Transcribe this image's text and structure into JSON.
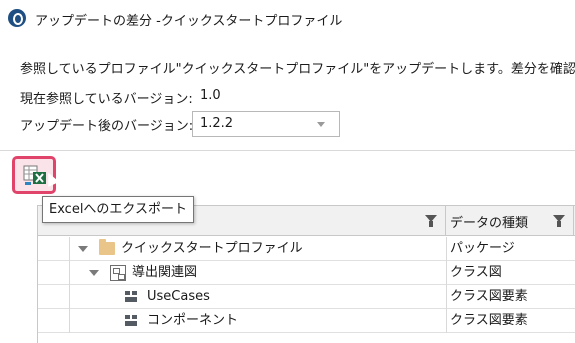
{
  "window": {
    "title": "アップデートの差分 -クイックスタートプロファイル",
    "app_icon": "astah-logo-icon"
  },
  "description": "参照しているプロファイル\"クイックスタートプロファイル\"をアップデートします。差分を確認し、問題が",
  "current_version": {
    "label": "現在参照しているバージョン:",
    "value": "1.0"
  },
  "updated_version": {
    "label": "アップデート後のバージョン:",
    "selected": "1.2.2"
  },
  "toolbar": {
    "export_icon": "excel-export-icon",
    "export_tooltip": "Excelへのエクスポート"
  },
  "table": {
    "columns": [
      {
        "label": "",
        "filter_icon": "filter-icon"
      },
      {
        "label": "データの種類",
        "filter_icon": "filter-icon"
      }
    ],
    "rows": [
      {
        "name": "クイックスタートプロファイル",
        "type": "パッケージ",
        "icon": "folder-icon",
        "expanded": true
      },
      {
        "name": "導出関連図",
        "type": "クラス図",
        "icon": "class-diagram-icon",
        "expanded": true
      },
      {
        "name": "UseCases",
        "type": "クラス図要素",
        "icon": "class-element-icon"
      },
      {
        "name": "コンポーネント",
        "type": "クラス図要素",
        "icon": "class-element-icon"
      }
    ]
  },
  "colors": {
    "highlight_border": "#e0446a",
    "header_background": "#f1f1f1"
  }
}
